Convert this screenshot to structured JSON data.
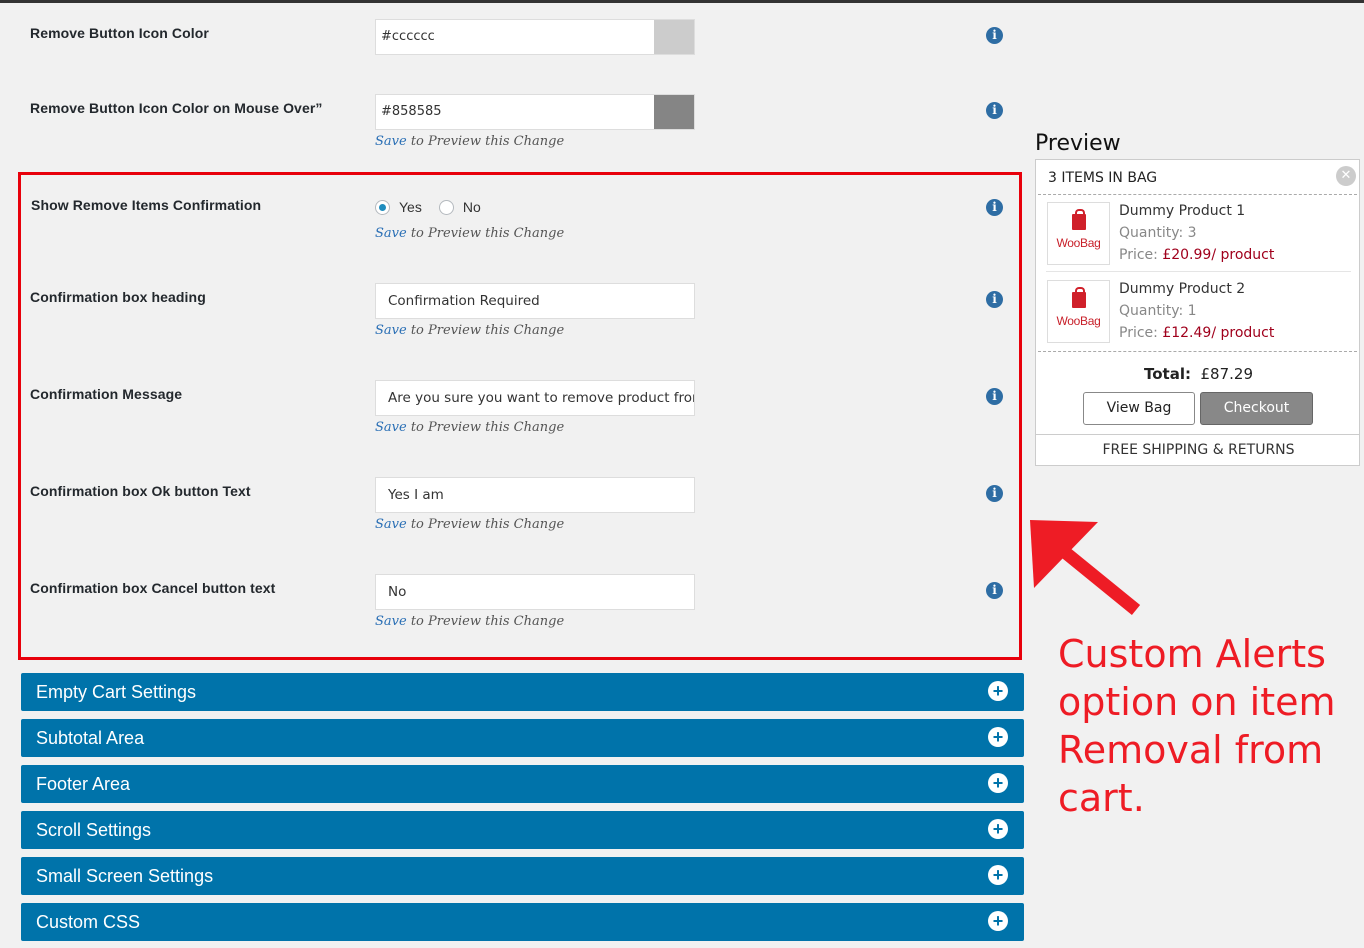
{
  "colors": {
    "accent_blue": "#0073aa",
    "highlight_red": "#e8000b",
    "annotation_red": "#ee1c25",
    "info_icon": "#2e6da4"
  },
  "save_hint": {
    "link": "Save",
    "rest": " to Preview this Change"
  },
  "rows": {
    "icon_color": {
      "label": "Remove Button Icon Color",
      "value": "#cccccc",
      "swatch": "#cccccc"
    },
    "icon_hover_color": {
      "label": "Remove Button Icon Color on Mouse Over”",
      "value": "#858585",
      "swatch": "#858585"
    },
    "show_confirmation": {
      "label": "Show Remove Items Confirmation",
      "options": [
        "Yes",
        "No"
      ],
      "selected": "Yes"
    },
    "box_heading": {
      "label": "Confirmation box heading",
      "value": "Confirmation  Required"
    },
    "message": {
      "label": "Confirmation Message",
      "value": "Are you sure you want to remove product from"
    },
    "ok_text": {
      "label": "Confirmation box Ok button Text",
      "value": "Yes I am"
    },
    "cancel_text": {
      "label": "Confirmation box Cancel button text",
      "value": "No"
    }
  },
  "accordions": [
    {
      "title": "Empty Cart Settings"
    },
    {
      "title": "Subtotal Area"
    },
    {
      "title": "Footer Area"
    },
    {
      "title": "Scroll Settings"
    },
    {
      "title": "Small Screen Settings"
    },
    {
      "title": "Custom CSS"
    }
  ],
  "preview": {
    "title": "Preview",
    "header": "3  ITEMS IN BAG",
    "items": [
      {
        "name": "Dummy Product 1",
        "qty_label": "Quantity:",
        "qty": "3",
        "price_label": "Price:",
        "price": "£20.99/ product",
        "brand": "WooBag"
      },
      {
        "name": "Dummy Product 2",
        "qty_label": "Quantity:",
        "qty": "1",
        "price_label": "Price:",
        "price": "£12.49/ product",
        "brand": "WooBag"
      }
    ],
    "total_label": "Total:",
    "total_value": "£87.29",
    "view_button": "View Bag",
    "checkout_button": "Checkout",
    "footer": "FREE SHIPPING & RETURNS"
  },
  "annotation": {
    "lines": [
      "Custom Alerts",
      "option on item",
      "Removal from",
      "cart."
    ]
  }
}
